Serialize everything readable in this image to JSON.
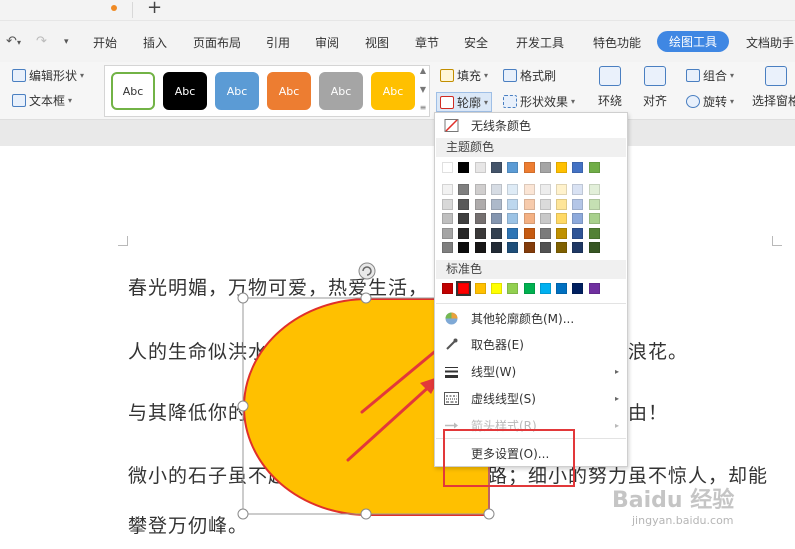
{
  "toolbar_menu": {
    "items": [
      "开始",
      "插入",
      "页面布局",
      "引用",
      "审阅",
      "视图",
      "章节",
      "安全",
      "开发工具",
      "特色功能",
      "绘图工具",
      "文档助手"
    ],
    "active": "绘图工具"
  },
  "ribbon": {
    "edit_shape": "编辑形状",
    "text_box": "文本框",
    "style_label": "Abc",
    "style_presets": [
      {
        "bg": "#ffffff",
        "fg": "#333333",
        "border": "#72b346"
      },
      {
        "bg": "#000000",
        "fg": "#ffffff",
        "border": "#000000"
      },
      {
        "bg": "#5b9bd5",
        "fg": "#ffffff",
        "border": "#5b9bd5"
      },
      {
        "bg": "#ed7d31",
        "fg": "#ffffff",
        "border": "#ed7d31"
      },
      {
        "bg": "#a5a5a5",
        "fg": "#ffffff",
        "border": "#a5a5a5"
      },
      {
        "bg": "#ffc000",
        "fg": "#ffffff",
        "border": "#ffc000"
      }
    ],
    "fill": "填充",
    "format_brush": "格式刷",
    "outline": "轮廓",
    "shape_effects": "形状效果",
    "wrap": "环绕",
    "align": "对齐",
    "group": "组合",
    "rotate": "旋转",
    "selection_pane": "选择窗格"
  },
  "document": {
    "lines": [
      "春光明媚，万物可爱，热爱生活，",
      "人的生命似洪水奔流，不遇着岛屿暗礁，难以激起美丽的浪花。",
      "与其降低你的目标，不如加倍努力，梦想不是你奋斗的理由！",
      "微小的石子虽不起眼，却能铺成宽阔的道路；细小的努力虽不惊人，却能",
      "攀登万仞峰。"
    ]
  },
  "outline_menu": {
    "no_line": "无线条颜色",
    "theme_header": "主题颜色",
    "theme_top_row": [
      "#ffffff",
      "#000000",
      "#e7e6e6",
      "#44546a",
      "#5b9bd5",
      "#ed7d31",
      "#a5a5a5",
      "#ffc000",
      "#4472c4",
      "#70ad47"
    ],
    "theme_shades": [
      [
        "#f2f2f2",
        "#7f7f7f",
        "#d0cece",
        "#d6dce4",
        "#deebf6",
        "#fbe5d5",
        "#ededed",
        "#fff2cc",
        "#d9e2f3",
        "#e2efd9"
      ],
      [
        "#d8d8d8",
        "#595959",
        "#aeabab",
        "#adb9ca",
        "#bdd7ee",
        "#f7cbac",
        "#dbdbdb",
        "#fee599",
        "#b4c6e7",
        "#c5e0b3"
      ],
      [
        "#bfbfbf",
        "#3f3f3f",
        "#757070",
        "#8496b0",
        "#9cc3e5",
        "#f4b183",
        "#c9c9c9",
        "#ffd965",
        "#8eaadb",
        "#a8d08d"
      ],
      [
        "#a5a5a5",
        "#262626",
        "#3a3838",
        "#323f4f",
        "#2e75b5",
        "#c55a11",
        "#7b7b7b",
        "#bf9000",
        "#2f5496",
        "#538135"
      ],
      [
        "#7f7f7f",
        "#0c0c0c",
        "#171616",
        "#222a35",
        "#1e4e79",
        "#833c0b",
        "#525252",
        "#7f6000",
        "#1f3864",
        "#375623"
      ]
    ],
    "standard_header": "标准色",
    "standard_colors": [
      "#c00000",
      "#ff0000",
      "#ffc000",
      "#ffff00",
      "#92d050",
      "#00b050",
      "#00b0f0",
      "#0070c0",
      "#002060",
      "#7030a0"
    ],
    "more_outline_colors": "其他轮廓颜色(M)...",
    "eyedropper": "取色器(E)",
    "line_style": "线型(W)",
    "dash_style": "虚线线型(S)",
    "arrow_style": "箭头样式(R)",
    "more_settings": "更多设置(O)..."
  },
  "watermark": {
    "brand": "Baidu 经验",
    "url": "jingyan.baidu.com"
  },
  "colors": {
    "shape_fill": "#ffc000",
    "shape_stroke": "#e0302a",
    "annotation_red": "#e2383a",
    "active_tab": "#3f87e3"
  }
}
